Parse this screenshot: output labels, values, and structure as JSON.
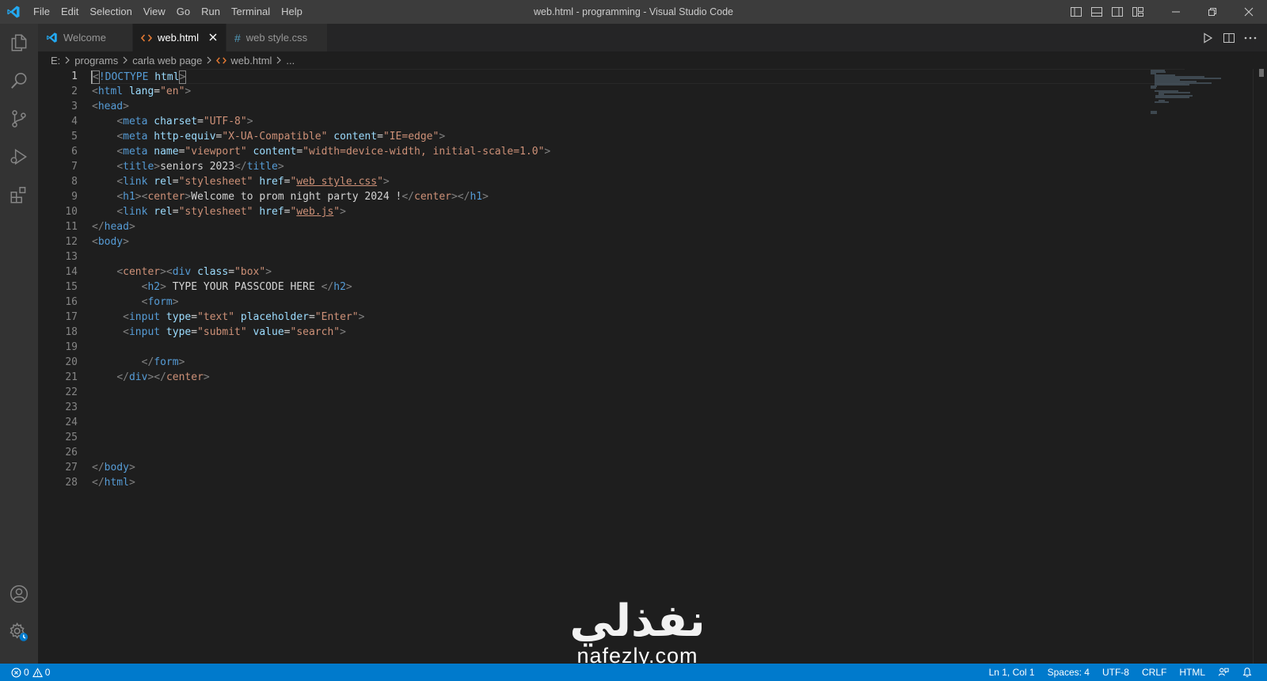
{
  "app": {
    "window_title": "web.html - programming - Visual Studio Code",
    "accent_color": "#007acc"
  },
  "menu": [
    "File",
    "Edit",
    "Selection",
    "View",
    "Go",
    "Run",
    "Terminal",
    "Help"
  ],
  "activity_bar": [
    "explorer-icon",
    "search-icon",
    "source-control-icon",
    "run-debug-icon",
    "extensions-icon",
    "account-icon",
    "manage-gear-icon"
  ],
  "tabs": [
    {
      "label": "Welcome",
      "icon": "vscode-logo-icon",
      "active": false
    },
    {
      "label": "web.html",
      "icon": "html-file-icon",
      "active": true
    },
    {
      "label": "web style.css",
      "icon": "css-hash-icon",
      "active": false
    }
  ],
  "breadcrumb": {
    "drive": "E:",
    "folder1": "programs",
    "folder2": "carla web page",
    "file": "web.html",
    "symbol": "..."
  },
  "editor": {
    "current_line": 1,
    "line_numbers": [
      "1",
      "2",
      "3",
      "4",
      "5",
      "6",
      "7",
      "8",
      "9",
      "10",
      "11",
      "12",
      "13",
      "14",
      "15",
      "16",
      "17",
      "18",
      "19",
      "20",
      "21",
      "22",
      "23",
      "24",
      "25",
      "26",
      "27",
      "28"
    ],
    "code": {
      "l1": [
        "<",
        "!DOCTYPE",
        " html",
        ">"
      ],
      "l2": [
        "<",
        "html",
        " lang",
        "=",
        "\"en\"",
        ">"
      ],
      "l3": [
        "<",
        "head",
        ">"
      ],
      "l4": [
        "    ",
        "<",
        "meta",
        " charset",
        "=",
        "\"UTF-8\"",
        ">"
      ],
      "l5": [
        "    ",
        "<",
        "meta",
        " http-equiv",
        "=",
        "\"X-UA-Compatible\"",
        " content",
        "=",
        "\"IE=edge\"",
        ">"
      ],
      "l6": [
        "    ",
        "<",
        "meta",
        " name",
        "=",
        "\"viewport\"",
        " content",
        "=",
        "\"width=device-width, initial-scale=1.0\"",
        ">"
      ],
      "l7": [
        "    ",
        "<",
        "title",
        ">",
        "seniors 2023",
        "</",
        "title",
        ">"
      ],
      "l8": [
        "    ",
        "<",
        "link",
        " rel",
        "=",
        "\"stylesheet\"",
        " href",
        "=",
        "\"",
        "web style.css",
        "\"",
        ">"
      ],
      "l9": [
        "    ",
        "<",
        "h1",
        "><",
        "center",
        ">",
        "Welcome to prom night party 2024 !",
        "</",
        "center",
        "></",
        "h1",
        ">"
      ],
      "l10": [
        "    ",
        "<",
        "link",
        " rel",
        "=",
        "\"stylesheet\"",
        " href",
        "=",
        "\"",
        "web.js",
        "\"",
        ">"
      ],
      "l11": [
        "</",
        "head",
        ">"
      ],
      "l12": [
        "<",
        "body",
        ">"
      ],
      "l14": [
        "    ",
        "<",
        "center",
        "><",
        "div",
        " class",
        "=",
        "\"box\"",
        ">"
      ],
      "l15": [
        "        ",
        "<",
        "h2",
        ">",
        " TYPE YOUR PASSCODE HERE ",
        "</",
        "h2",
        ">"
      ],
      "l16": [
        "        ",
        "<",
        "form",
        ">"
      ],
      "l17": [
        "     ",
        "<",
        "input",
        " type",
        "=",
        "\"text\"",
        " placeholder",
        "=",
        "\"Enter\"",
        ">"
      ],
      "l18": [
        "     ",
        "<",
        "input",
        " type",
        "=",
        "\"submit\"",
        " value",
        "=",
        "\"search\"",
        ">"
      ],
      "l20": [
        "        ",
        "</",
        "form",
        ">"
      ],
      "l21": [
        "    ",
        "</",
        "div",
        "></",
        "center",
        ">"
      ],
      "l27": [
        "</",
        "body",
        ">"
      ],
      "l28": [
        "</",
        "html",
        ">"
      ]
    }
  },
  "watermark": {
    "arabic": "نفذلي",
    "url": "nafezly.com"
  },
  "status_bar": {
    "errors": "0",
    "warnings": "0",
    "cursor_position": "Ln 1, Col 1",
    "indentation": "Spaces: 4",
    "encoding": "UTF-8",
    "eol": "CRLF",
    "language": "HTML"
  }
}
